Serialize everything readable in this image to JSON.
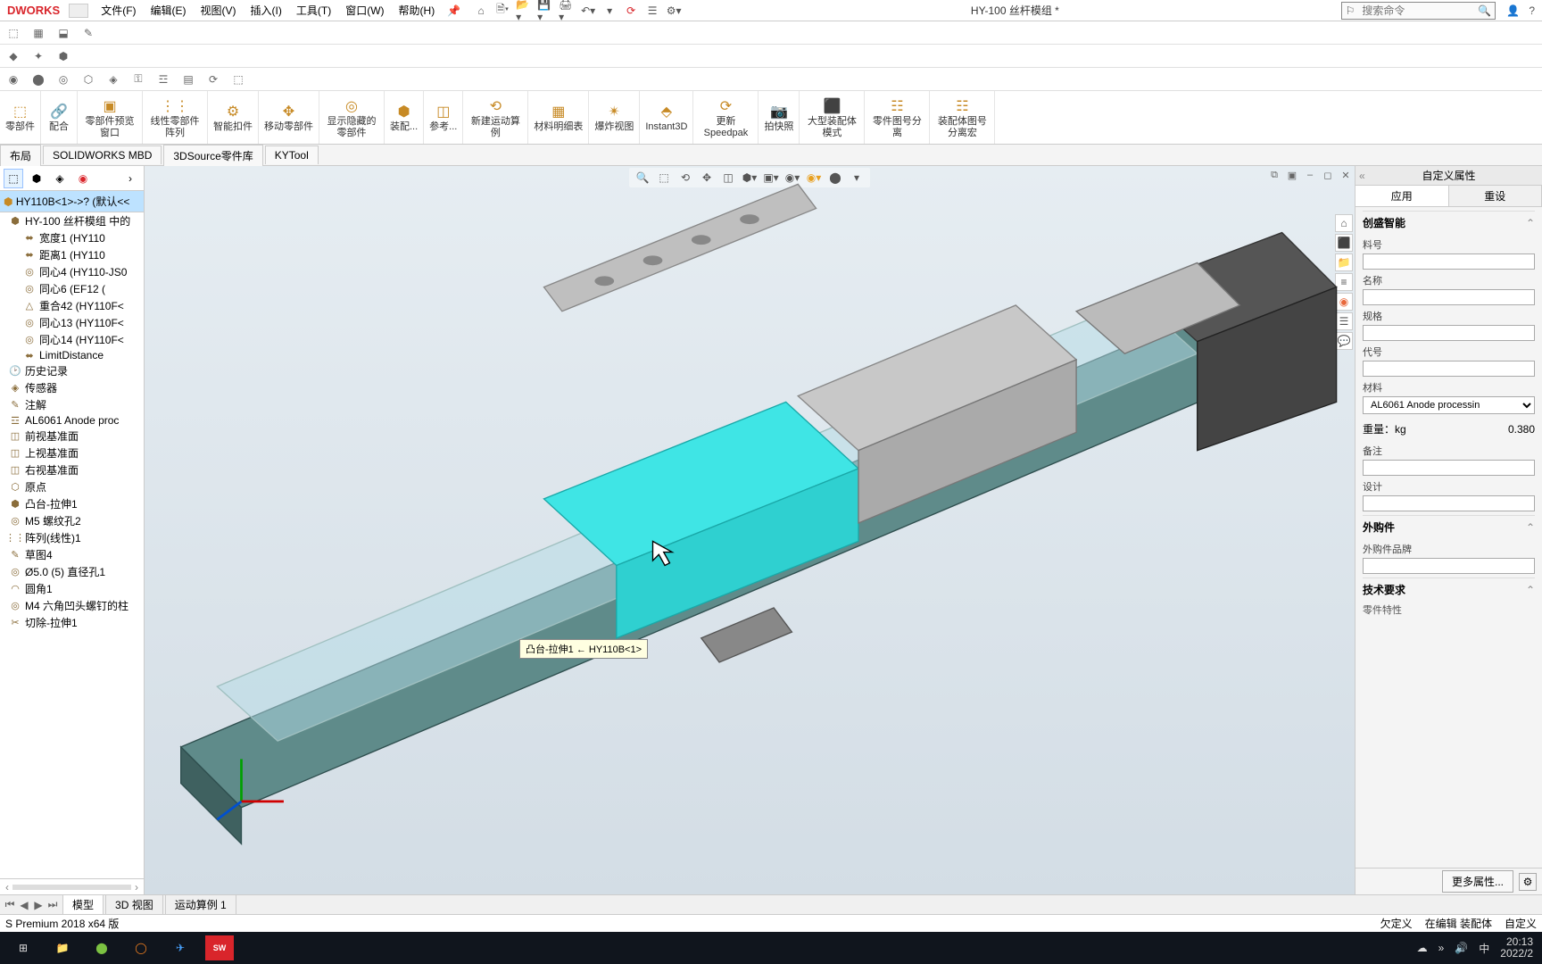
{
  "app": {
    "logo": "DWORKS",
    "doc_title": "HY-100 丝杆模组 *"
  },
  "menu": {
    "file": "文件(F)",
    "edit": "编辑(E)",
    "view": "视图(V)",
    "insert": "插入(I)",
    "tools": "工具(T)",
    "window": "窗口(W)",
    "help": "帮助(H)"
  },
  "search": {
    "placeholder": "搜索命令"
  },
  "ribbon": {
    "items": [
      "零部件",
      "配合",
      "零部件预览窗口",
      "线性零部件阵列",
      "智能扣件",
      "移动零部件",
      "显示隐藏的零部件",
      "装配...",
      "参考...",
      "新建运动算例",
      "材料明细表",
      "爆炸视图",
      "Instant3D",
      "更新Speedpak",
      "拍快照",
      "大型装配体模式",
      "零件图号分离",
      "装配体图号分离宏"
    ]
  },
  "cmd_tabs": {
    "items": [
      "布局",
      "SOLIDWORKS MBD",
      "3DSource零件库",
      "KYTool"
    ]
  },
  "tree": {
    "title": "HY110B<1>->? (默认<<",
    "items": [
      "HY-100 丝杆模组 中的",
      "宽度1 (HY110",
      "距离1 (HY110",
      "同心4 (HY110-JS0",
      "同心6 (EF12  (",
      "重合42 (HY110F<",
      "同心13 (HY110F<",
      "同心14 (HY110F<",
      "LimitDistance",
      "历史记录",
      "传感器",
      "注解",
      "AL6061 Anode proc",
      "前视基准面",
      "上视基准面",
      "右视基准面",
      "原点",
      "凸台-拉伸1",
      "M5 螺纹孔2",
      "阵列(线性)1",
      "草图4",
      "Ø5.0 (5) 直径孔1",
      "圆角1",
      "M4 六角凹头螺钉的柱",
      "切除-拉伸1"
    ]
  },
  "viewport": {
    "tooltip": "凸台-拉伸1 ← HY110B<1>"
  },
  "props": {
    "title": "自定义属性",
    "tab_apply": "应用",
    "tab_reset": "重设",
    "section_smart": "创盛智能",
    "field_partno": "料号",
    "field_name": "名称",
    "field_spec": "规格",
    "field_code": "代号",
    "field_material": "材料",
    "material_value": "AL6061 Anode processin",
    "weight_label": "重量：kg",
    "weight_value": "0.380",
    "field_remark": "备注",
    "field_design": "设计",
    "section_purchase": "外购件",
    "field_brand": "外购件品牌",
    "section_tech": "技术要求",
    "tech_subtitle": "零件特性",
    "more_btn": "更多属性..."
  },
  "bottom_tabs": {
    "model": "模型",
    "view3d": "3D 视图",
    "motion": "运动算例 1"
  },
  "status": {
    "edition": "S Premium 2018 x64 版",
    "under_def": "欠定义",
    "editing": "在编辑 装配体",
    "custom": "自定义"
  },
  "taskbar": {
    "time": "20:13",
    "date": "2022/2",
    "ime": "中"
  }
}
